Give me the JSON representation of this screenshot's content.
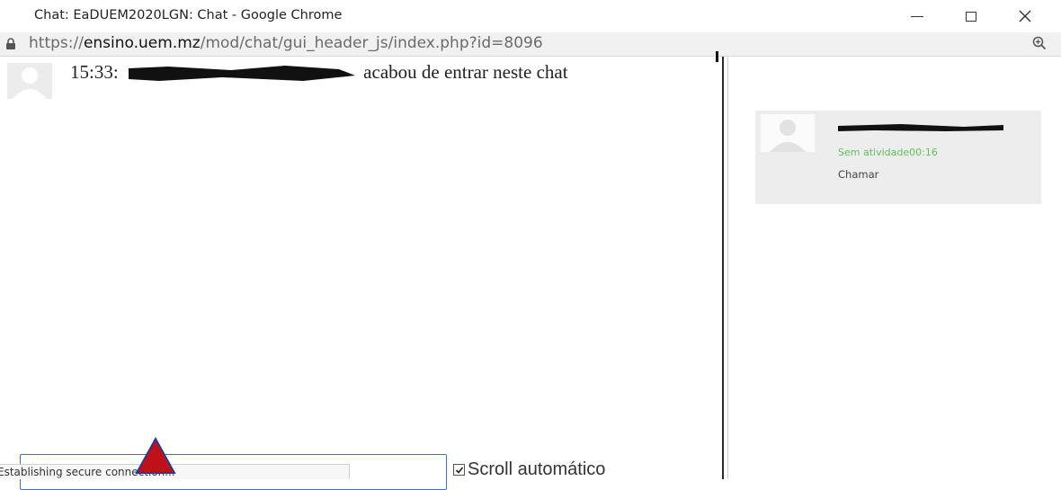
{
  "window": {
    "title": "Chat: EaDUEM2020LGN: Chat - Google Chrome",
    "controls": [
      "minimize-icon",
      "maximize-icon",
      "close-icon"
    ]
  },
  "address_bar": {
    "scheme": "https://",
    "domain": "ensino.uem.mz",
    "path": "/mod/chat/gui_header_js/index.php?id=8096",
    "icons": [
      "lock-icon",
      "zoom-icon"
    ]
  },
  "messages": [
    {
      "time": "15:33:",
      "text": "acabou de entrar neste chat",
      "author_redacted": true
    }
  ],
  "input": {
    "value": "",
    "placeholder": ""
  },
  "autoscroll": {
    "label": "Scroll automático",
    "checked": true
  },
  "status_bar": {
    "text": "Establishing secure connection..."
  },
  "users": [
    {
      "name_redacted": true,
      "status": "Sem atividade00:16",
      "action": "Chamar"
    }
  ],
  "colors": {
    "status_green": "#5cc35c",
    "input_border": "#3b6fd4",
    "divider": "#2b2b2b",
    "cursor_red": "#c0101a"
  }
}
